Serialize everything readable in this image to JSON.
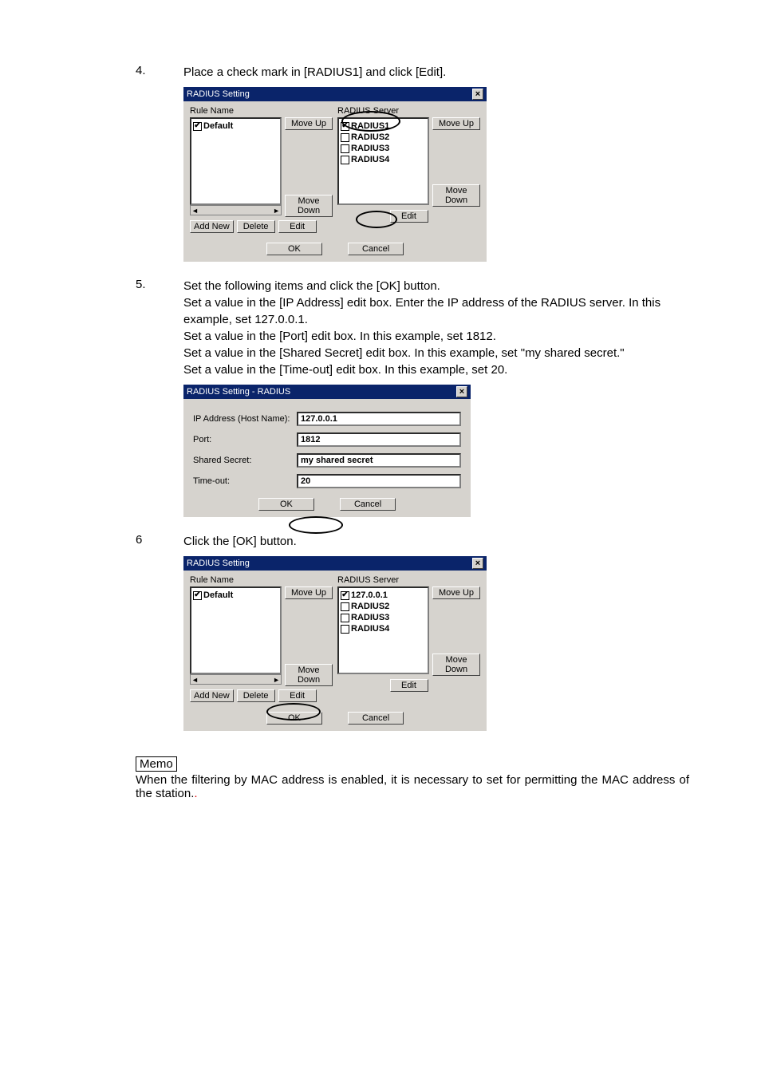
{
  "steps": {
    "s4": {
      "num": "4.",
      "text": "Place a check mark in [RADIUS1] and click [Edit]."
    },
    "s5": {
      "num": "5.",
      "l1": "Set the following items and click the [OK] button.",
      "l2": "Set a value in the [IP Address] edit box.  Enter the IP address of the RADIUS server.  In this example, set 127.0.0.1.",
      "l3": "Set a value in the [Port] edit box.  In this example, set 1812.",
      "l4": "Set a value in the [Shared Secret] edit box.  In this example, set \"my shared secret.\"",
      "l5": "Set a value in the [Time-out] edit box.  In this example, set 20."
    },
    "s6": {
      "num": "6",
      "text": "Click the [OK] button."
    }
  },
  "dlg1": {
    "title": "RADIUS Setting",
    "rule_label": "Rule Name",
    "server_label": "RADIUS Server",
    "rule_items": [
      {
        "label": "Default",
        "checked": true
      }
    ],
    "server_items": [
      {
        "label": "RADIUS1",
        "checked": true
      },
      {
        "label": "RADIUS2",
        "checked": false
      },
      {
        "label": "RADIUS3",
        "checked": false
      },
      {
        "label": "RADIUS4",
        "checked": false
      }
    ],
    "move_up": "Move Up",
    "move_down": "Move Down",
    "add_new": "Add New",
    "delete": "Delete",
    "edit": "Edit",
    "ok": "OK",
    "cancel": "Cancel"
  },
  "dlg2": {
    "title": "RADIUS Setting - RADIUS",
    "ip_label": "IP Address (Host Name):",
    "ip_val": "127.0.0.1",
    "port_label": "Port:",
    "port_val": "1812",
    "secret_label": "Shared Secret:",
    "secret_val": "my shared secret",
    "timeout_label": "Time-out:",
    "timeout_val": "20",
    "ok": "OK",
    "cancel": "Cancel"
  },
  "dlg3": {
    "title": "RADIUS Setting",
    "rule_label": "Rule Name",
    "server_label": "RADIUS Server",
    "rule_items": [
      {
        "label": "Default",
        "checked": true
      }
    ],
    "server_items": [
      {
        "label": "127.0.0.1",
        "checked": true
      },
      {
        "label": "RADIUS2",
        "checked": false
      },
      {
        "label": "RADIUS3",
        "checked": false
      },
      {
        "label": "RADIUS4",
        "checked": false
      }
    ],
    "move_up": "Move Up",
    "move_down": "Move Down",
    "add_new": "Add New",
    "delete": "Delete",
    "edit": "Edit",
    "ok": "OK",
    "cancel": "Cancel"
  },
  "memo": {
    "label": "Memo",
    "text": "When the filtering by MAC address is enabled, it is necessary to set for permitting the MAC address of the station."
  }
}
